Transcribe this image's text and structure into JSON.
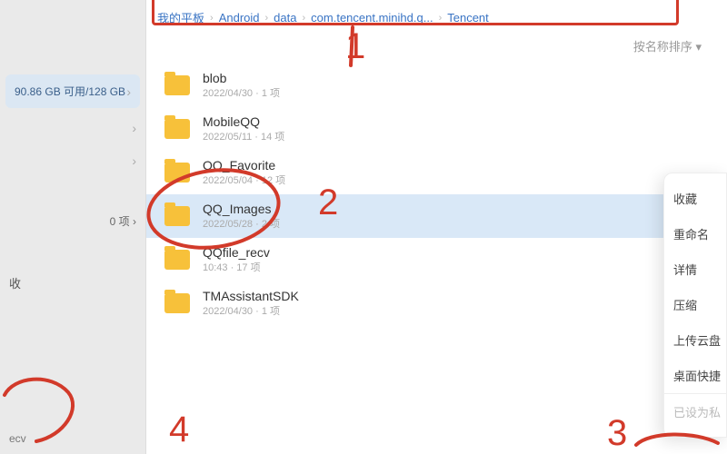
{
  "colors": {
    "accent": "#3a74c4",
    "folder": "#f7c13a",
    "annotation": "#d23a2a",
    "selection": "#d9e8f7"
  },
  "sidebar": {
    "storage": "90.86 GB 可用/128 GB",
    "zeroItems": "0 项",
    "favLabel": "收",
    "bottomLabel": "ecv"
  },
  "breadcrumb": [
    "我的平板",
    "Android",
    "data",
    "com.tencent.minihd.q...",
    "Tencent"
  ],
  "sort": {
    "label": "按名称排序 ▾"
  },
  "folders": [
    {
      "name": "blob",
      "sub": "2022/04/30 · 1 项"
    },
    {
      "name": "MobileQQ",
      "sub": "2022/05/11 · 14 项"
    },
    {
      "name": "QQ_Favorite",
      "sub": "2022/05/04 · 12 项"
    },
    {
      "name": "QQ_Images",
      "sub": "2022/05/28 · 2 项"
    },
    {
      "name": "QQfile_recv",
      "sub": "10:43 · 17 项"
    },
    {
      "name": "TMAssistantSDK",
      "sub": "2022/04/30 · 1 项"
    }
  ],
  "contextMenu": {
    "items": [
      "收藏",
      "重命名",
      "详情",
      "压缩",
      "上传云盘",
      "桌面快捷"
    ],
    "footer": "已设为私"
  },
  "annotations": {
    "n1": "1",
    "n2": "2",
    "n3": "3",
    "n4": "4"
  }
}
